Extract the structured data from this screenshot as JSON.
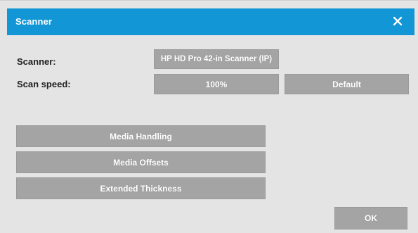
{
  "dialog": {
    "title": "Scanner",
    "close_icon": "close-icon"
  },
  "settings": {
    "scanner_label": "Scanner:",
    "scanner_value": "HP HD Pro 42-in Scanner (IP)",
    "scan_speed_label": "Scan speed:",
    "scan_speed_value": "100%",
    "default_label": "Default"
  },
  "actions": {
    "media_handling": "Media Handling",
    "media_offsets": "Media Offsets",
    "extended_thickness": "Extended Thickness",
    "ok": "OK"
  },
  "colors": {
    "titlebar": "#1296d6",
    "button": "#a4a4a4",
    "dialog_bg": "#e4e4e4"
  }
}
